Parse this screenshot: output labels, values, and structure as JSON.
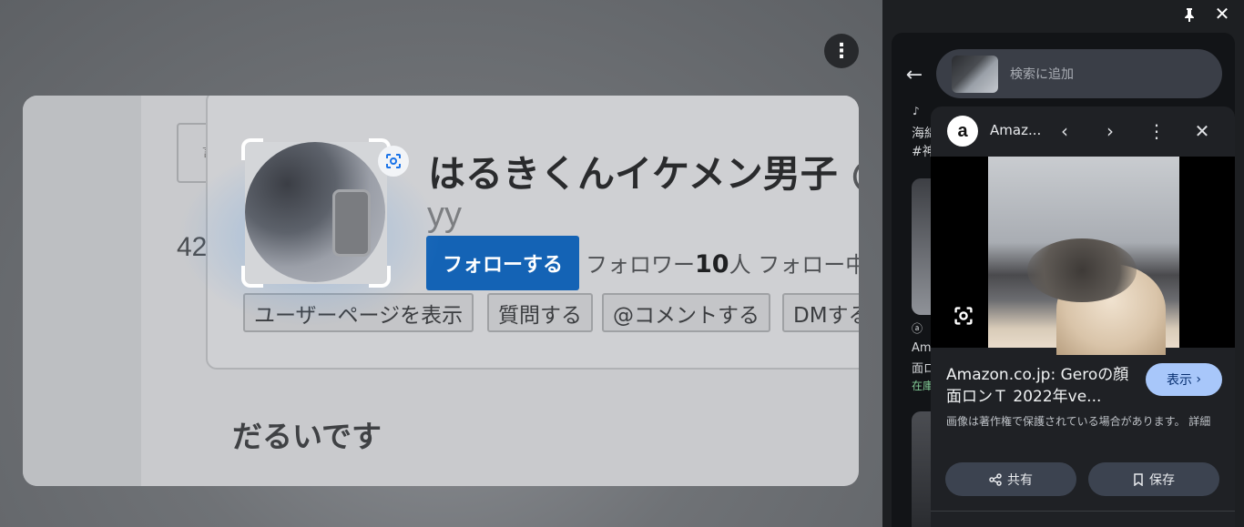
{
  "page": {
    "menu_icon": "more-vert-icon",
    "ghost_box_text": "言",
    "ghost_number": "42",
    "username": "はるきくんイケメン男子",
    "username_at": "@",
    "handle": "yy",
    "follow_button": "フォローする",
    "followers_label": "フォロワー",
    "followers_count": "10",
    "followers_unit": "人",
    "following_label": "フォロー中",
    "actions": [
      "ユーザーページを表示",
      "質問する",
      "@コメントする",
      "DMする"
    ],
    "bottom_text": "だるいです"
  },
  "panel": {
    "search_placeholder": "検索に追加",
    "bg_results": {
      "line1": "海綿",
      "line2": "#神",
      "line3": "Am",
      "line4": "面ロ",
      "line5": "在庫"
    },
    "detail": {
      "source_logo": "a",
      "source_name": "Amaz...",
      "title": "Amazon.co.jp: Geroの顔面ロンＴ 2022年ve...",
      "view_button": "表示",
      "copyright": "画像は著作権で保護されている場合があります。 詳細",
      "share_button": "共有",
      "save_button": "保存"
    }
  },
  "colors": {
    "follow_blue": "#1463b5",
    "view_button_bg": "#a8c7fa",
    "in_stock_green": "#81c995"
  }
}
